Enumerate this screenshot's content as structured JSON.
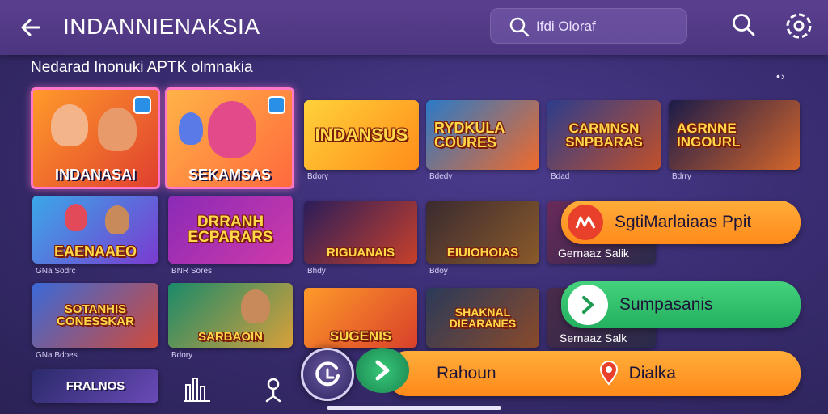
{
  "header": {
    "title": "INDANNIENAKSIA",
    "search_placeholder": "Ifdi Oloraf",
    "back_icon": "arrow-left-icon",
    "search_icon": "search-icon",
    "settings_icon": "gear-icon"
  },
  "section": {
    "title": "Nedarad Inonuki APTK olmnakia",
    "more": "•›"
  },
  "cards": [
    {
      "title": "INDANASAI",
      "meta": "",
      "colors": [
        "#ff8a2a",
        "#e0402f"
      ],
      "title_color": "white"
    },
    {
      "title": "SEKAMSAS",
      "meta": "",
      "colors": [
        "#ffb347",
        "#ff6a3d"
      ],
      "title_color": "white"
    },
    {
      "title": "INDANSUS",
      "meta": "Bdory",
      "colors": [
        "#ffd23a",
        "#ff8c1a"
      ]
    },
    {
      "title": "RYDKULA COURES",
      "meta": "Bdedy",
      "colors": [
        "#2a7ac8",
        "#f06a2a"
      ]
    },
    {
      "title": "CARMNSN SNPBARAS",
      "meta": "Bdad",
      "colors": [
        "#2d3d8c",
        "#c0502a"
      ]
    },
    {
      "title": "AGRNNE INGOURL",
      "meta": "Bdrry",
      "colors": [
        "#1b1b4a",
        "#d4662a"
      ]
    },
    {
      "title": "EAENAAEO",
      "meta": "GNa Sodrc",
      "colors": [
        "#3aa8e8",
        "#7a3ad0"
      ]
    },
    {
      "title": "DRRANH ECPARARS",
      "meta": "BNR Sores",
      "colors": [
        "#8a2ab8",
        "#d03aa8"
      ]
    },
    {
      "title": "RIGUANAIS",
      "meta": "Bhdy",
      "colors": [
        "#2a1d5a",
        "#c8402a"
      ]
    },
    {
      "title": "EIUIOHOIAS",
      "meta": "Bdoy",
      "colors": [
        "#3a2a30",
        "#8a5a2a"
      ]
    },
    {
      "title": "SOTANHIS CONESSKAR",
      "meta": "GNa Bdoes",
      "colors": [
        "#3a6ad8",
        "#d04a3a"
      ]
    },
    {
      "title": "SARBAOIN",
      "meta": "Bdory",
      "colors": [
        "#1a8a6a",
        "#d8a03a"
      ]
    },
    {
      "title": "SUGENIS",
      "meta": "",
      "colors": [
        "#ff9a2a",
        "#d8402a"
      ]
    },
    {
      "title": "SHAKNAL DIEARANES",
      "meta": "",
      "colors": [
        "#2a3a5a",
        "#8a4a2a"
      ]
    },
    {
      "title": "FRALNOS",
      "meta": "",
      "colors": [
        "#2a2a6a",
        "#6a4ab8"
      ]
    }
  ],
  "card_labels": {
    "row2_overlay": "Gernaaz Salik",
    "row3_overlay": "Sernaaz Salk"
  },
  "actions": {
    "primary_pill": "SgtiMarlaiaas Ppit",
    "secondary_pill": "Sumpasanis",
    "left_bottom": "Rahoun",
    "right_bottom": "Dialka"
  },
  "icons": {
    "bottom_nav": [
      "chart-icon",
      "person-pin-icon"
    ],
    "circle_button": "refresh-icon",
    "go_button": "chevron-right-icon"
  },
  "colors": {
    "accent_orange": "#ff8a1a",
    "accent_green": "#23b05f",
    "bg": "#3a2d72"
  }
}
